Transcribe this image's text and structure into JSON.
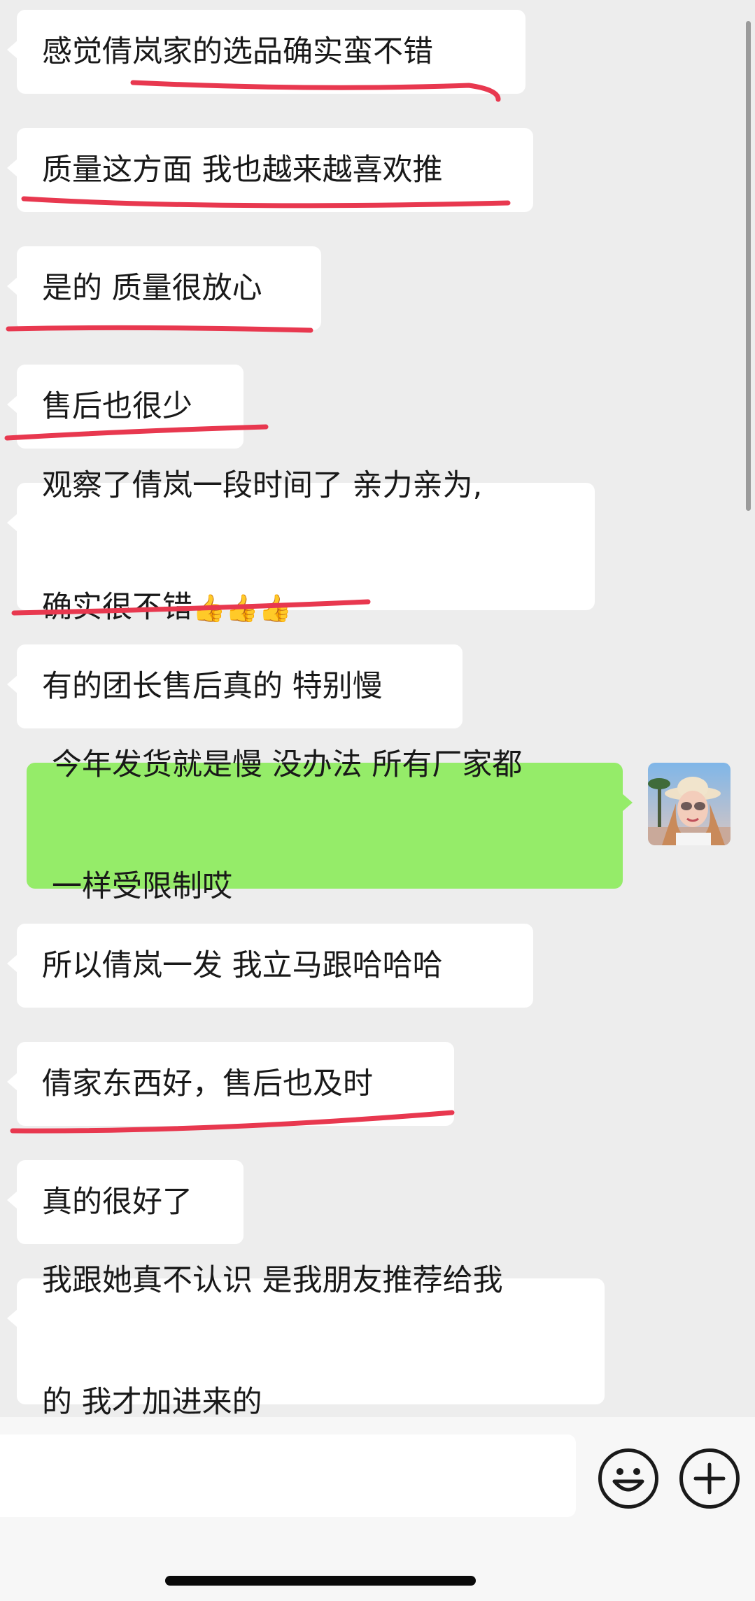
{
  "messages": [
    {
      "side": "left",
      "text": "感觉倩岚家的选品确实蛮不错"
    },
    {
      "side": "left",
      "text": "质量这方面 我也越来越喜欢推"
    },
    {
      "side": "left",
      "text": "是的 质量很放心"
    },
    {
      "side": "left",
      "text": "售后也很少"
    },
    {
      "side": "left",
      "line1": "观察了倩岚一段时间了 亲力亲为,",
      "line2": "确实很不错",
      "emoji": "👍👍👍"
    },
    {
      "side": "left",
      "text": "有的团长售后真的 特别慢"
    },
    {
      "side": "right",
      "line1": "今年发货就是慢 没办法 所有厂家都",
      "line2": "一样受限制哎"
    },
    {
      "side": "left",
      "text": "所以倩岚一发 我立马跟哈哈哈"
    },
    {
      "side": "left",
      "text": "倩家东西好，售后也及时"
    },
    {
      "side": "left",
      "text": "真的很好了"
    },
    {
      "side": "left",
      "line1": "我跟她真不认识 是我朋友推荐给我",
      "line2": "的 我才加进来的"
    }
  ],
  "colors": {
    "background": "#ededed",
    "left_bubble": "#ffffff",
    "right_bubble": "#95ec69",
    "underline": "#e8384f"
  },
  "icons": {
    "emoji_button": "smiley-face-icon",
    "more_button": "plus-circle-icon"
  }
}
